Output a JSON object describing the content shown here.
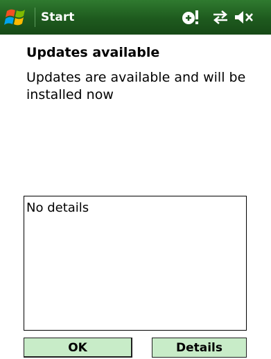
{
  "titlebar": {
    "title": "Start",
    "icons": [
      "windows-start-icon",
      "notification-icon",
      "connectivity-icon",
      "volume-muted-icon"
    ],
    "background_color": "#1e5a1e"
  },
  "dialog": {
    "heading": "Updates available",
    "message": "Updates are available and will be installed now",
    "details_text": "No details"
  },
  "buttons": {
    "ok_label": "OK",
    "details_label": "Details",
    "button_color": "#c8ecc8"
  }
}
